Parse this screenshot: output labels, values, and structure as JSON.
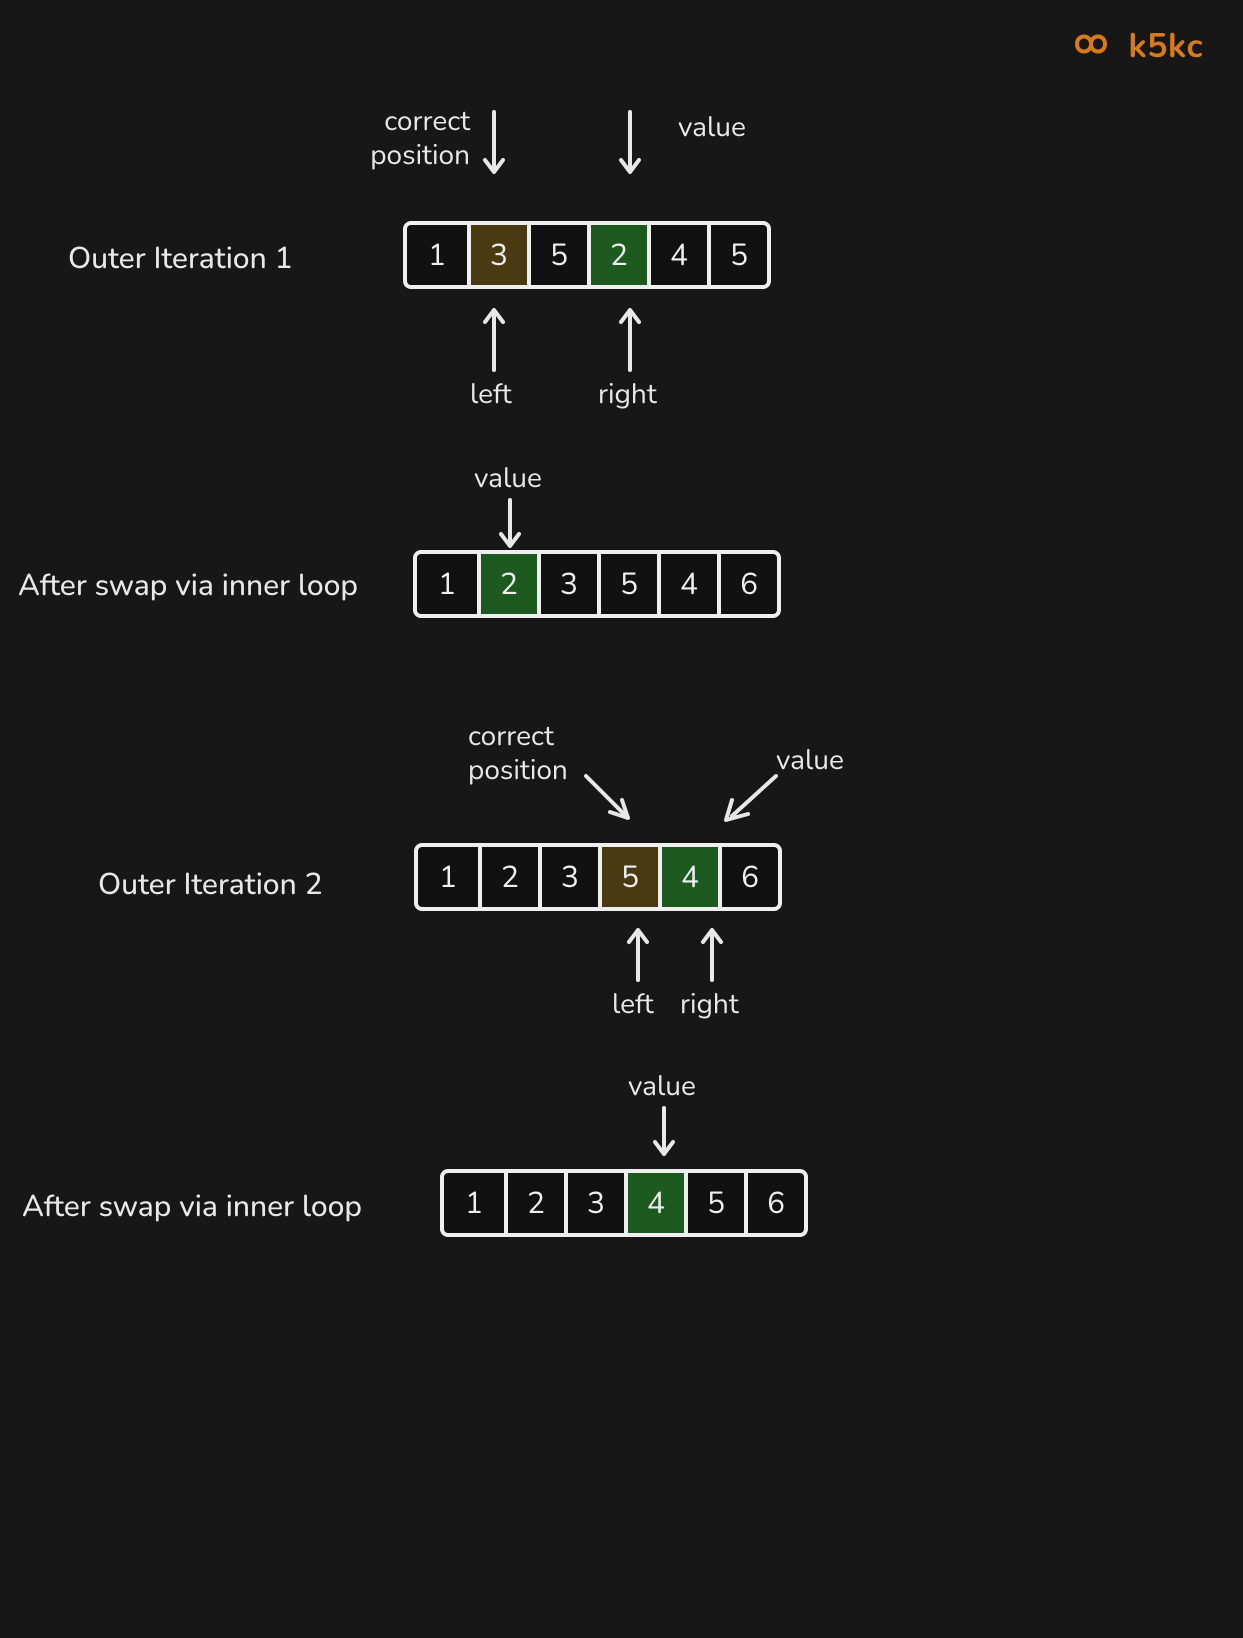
{
  "brand": {
    "name": "k5kc"
  },
  "labels": {
    "correct_position": "correct\nposition",
    "value": "value",
    "left": "left",
    "right": "right",
    "outer1": "Outer Iteration 1",
    "after_swap": "After swap via inner loop",
    "outer2": "Outer Iteration 2"
  },
  "arrays": {
    "row1": [
      {
        "v": "1",
        "fill": ""
      },
      {
        "v": "3",
        "fill": "olive"
      },
      {
        "v": "5",
        "fill": ""
      },
      {
        "v": "2",
        "fill": "green"
      },
      {
        "v": "4",
        "fill": ""
      },
      {
        "v": "5",
        "fill": ""
      }
    ],
    "row2": [
      {
        "v": "1",
        "fill": ""
      },
      {
        "v": "2",
        "fill": "green"
      },
      {
        "v": "3",
        "fill": ""
      },
      {
        "v": "5",
        "fill": ""
      },
      {
        "v": "4",
        "fill": ""
      },
      {
        "v": "6",
        "fill": ""
      }
    ],
    "row3": [
      {
        "v": "1",
        "fill": ""
      },
      {
        "v": "2",
        "fill": ""
      },
      {
        "v": "3",
        "fill": ""
      },
      {
        "v": "5",
        "fill": "olive"
      },
      {
        "v": "4",
        "fill": "green"
      },
      {
        "v": "6",
        "fill": ""
      }
    ],
    "row4": [
      {
        "v": "1",
        "fill": ""
      },
      {
        "v": "2",
        "fill": ""
      },
      {
        "v": "3",
        "fill": ""
      },
      {
        "v": "4",
        "fill": "green"
      },
      {
        "v": "5",
        "fill": ""
      },
      {
        "v": "6",
        "fill": ""
      }
    ]
  },
  "colors": {
    "bg": "#171717",
    "stroke": "#efefef",
    "accent": "#d97a1a",
    "olive": "#4a3a12",
    "green": "#1c5a1f"
  }
}
